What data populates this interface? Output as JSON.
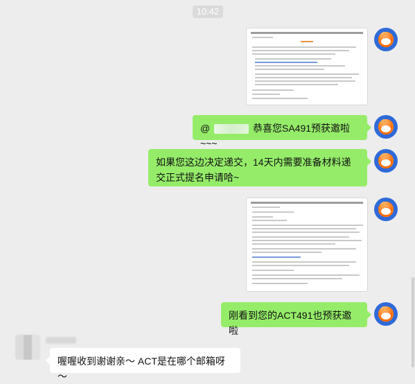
{
  "timestamp": "10:42",
  "messages": [
    {
      "type": "image",
      "side": "right",
      "description_icon": "email-screenshot"
    },
    {
      "type": "text",
      "side": "right",
      "prefix": "@",
      "text": "恭喜您SA491预获邀啦~~~"
    },
    {
      "type": "text",
      "side": "right",
      "text": "如果您这边决定递交，14天内需要准备材料递交正式提名申请哈~"
    },
    {
      "type": "image",
      "side": "right",
      "description_icon": "email-screenshot"
    },
    {
      "type": "text",
      "side": "right",
      "text": "刚看到您的ACT491也预获邀啦"
    },
    {
      "type": "text",
      "side": "left",
      "text": "喔喔收到谢谢亲～ ACT是在哪个邮箱呀～"
    }
  ],
  "colors": {
    "background": "#ededed",
    "self_bubble": "#95ec69",
    "other_bubble": "#ffffff"
  }
}
